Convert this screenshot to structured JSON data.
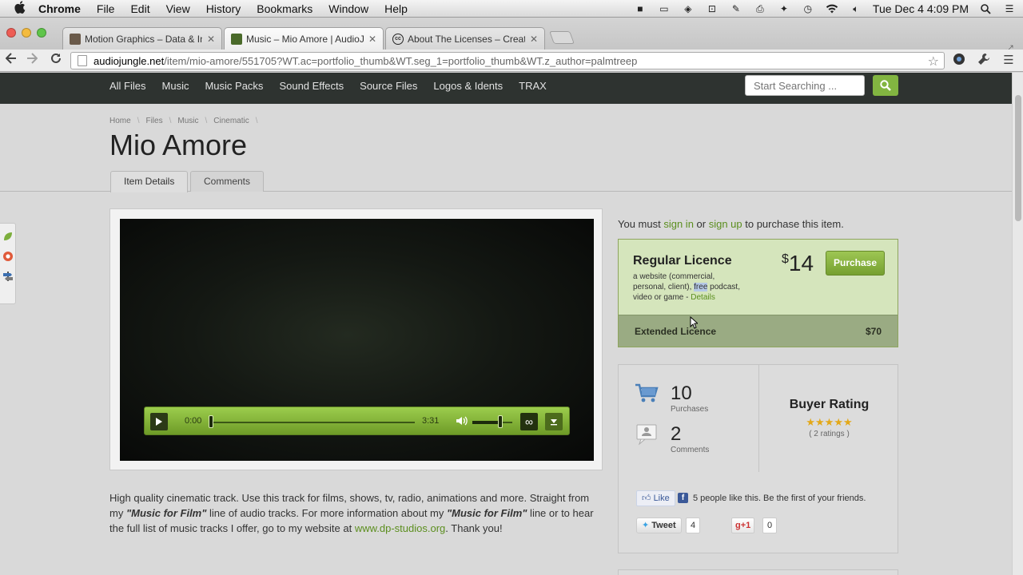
{
  "menubar": {
    "app_name": "Chrome",
    "items": [
      "File",
      "Edit",
      "View",
      "History",
      "Bookmarks",
      "Window",
      "Help"
    ],
    "clock": "Tue Dec 4  4:09 PM"
  },
  "tabs": [
    {
      "label": "Motion Graphics – Data & In",
      "favicon_color": "#6a5a4a"
    },
    {
      "label": "Music – Mio Amore | AudioJ",
      "favicon_color": "#4a6a2a"
    },
    {
      "label": "About The Licenses – Creati",
      "favicon_color": "#222222"
    }
  ],
  "omnibox": {
    "host": "audiojungle.net",
    "path": "/item/mio-amore/551705?WT.ac=portfolio_thumb&WT.seg_1=portfolio_thumb&WT.z_author=palmtreep"
  },
  "site_nav": {
    "links": [
      "All Files",
      "Music",
      "Music Packs",
      "Sound Effects",
      "Source Files",
      "Logos & Idents",
      "TRAX"
    ],
    "search_placeholder": "Start Searching ..."
  },
  "breadcrumb": [
    "Home",
    "Files",
    "Music",
    "Cinematic"
  ],
  "page_title": "Mio Amore",
  "page_tabs": [
    "Item Details",
    "Comments"
  ],
  "player": {
    "current_time": "0:00",
    "duration": "3:31",
    "progress_fraction": 0.0,
    "volume_fraction": 0.7
  },
  "description": {
    "part1": "High quality cinematic track. Use this track for films, shows, tv, radio, animations and more. Straight from my ",
    "em1": "\"Music for Film\"",
    "part2": " line of audio tracks. For more information about my ",
    "em2": "\"Music for Film\"",
    "part3": " line or to hear the full list of music tracks I offer, go to my website at ",
    "link": "www.dp-studios.org",
    "part4": ". Thank you!"
  },
  "purchase": {
    "must_prefix": "You must ",
    "sign_in": "sign in",
    "or": " or ",
    "sign_up": "sign up",
    "must_suffix": " to purchase this item.",
    "regular_title": "Regular Licence",
    "regular_desc_1": "a website (commercial, personal, client), ",
    "regular_desc_hl": "free",
    "regular_desc_2": " podcast, video or game - ",
    "details_link": "Details",
    "currency": "$",
    "price": "14",
    "purchase_label": "Purchase",
    "extended_title": "Extended Licence",
    "extended_price": "$70"
  },
  "stats": {
    "purchases_count": "10",
    "purchases_label": "Purchases",
    "comments_count": "2",
    "comments_label": "Comments",
    "rating_title": "Buyer Rating",
    "stars": "★★★★★",
    "rating_count": "( 2 ratings )"
  },
  "social": {
    "like_label": "Like",
    "like_text": "5 people like this. Be the first of your friends.",
    "tweet_label": "Tweet",
    "tweet_count": "4",
    "gplus_label": "+1",
    "gplus_count": "0"
  },
  "colors": {
    "accent_green": "#82b541",
    "nav_bg": "#2e3330",
    "licence_bg": "#d5e5bc"
  }
}
